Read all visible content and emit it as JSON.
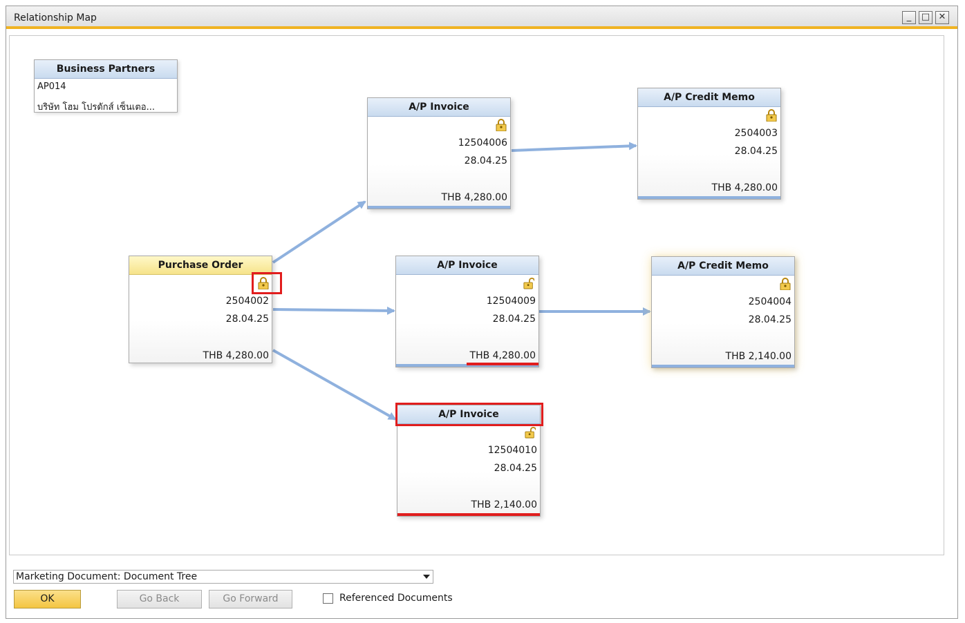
{
  "window": {
    "title": "Relationship Map",
    "minimize": "_",
    "maximize": "□",
    "close": "✕"
  },
  "business_partner": {
    "header": "Business Partners",
    "code": "AP014",
    "name": "บริษัท โฮม โปรดักส์ เซ็นเตอ..."
  },
  "documents": [
    {
      "id": "po",
      "header": "Purchase Order",
      "number": "2504002",
      "date": "28.04.25",
      "amount": "THB 4,280.00",
      "lock": "locked"
    },
    {
      "id": "inv1",
      "header": "A/P Invoice",
      "number": "12504006",
      "date": "28.04.25",
      "amount": "THB 4,280.00",
      "lock": "locked"
    },
    {
      "id": "inv2",
      "header": "A/P Invoice",
      "number": "12504009",
      "date": "28.04.25",
      "amount": "THB 4,280.00",
      "lock": "unlocked"
    },
    {
      "id": "inv3",
      "header": "A/P Invoice",
      "number": "12504010",
      "date": "28.04.25",
      "amount": "THB 2,140.00",
      "lock": "unlocked"
    },
    {
      "id": "cm1",
      "header": "A/P Credit Memo",
      "number": "2504003",
      "date": "28.04.25",
      "amount": "THB 4,280.00",
      "lock": "locked"
    },
    {
      "id": "cm2",
      "header": "A/P Credit Memo",
      "number": "2504004",
      "date": "28.04.25",
      "amount": "THB 2,140.00",
      "lock": "locked"
    }
  ],
  "footer": {
    "view_select": "Marketing Document: Document Tree",
    "ok": "OK",
    "go_back": "Go Back",
    "go_forward": "Go Forward",
    "referenced_documents": "Referenced Documents",
    "referenced_checked": false
  },
  "colors": {
    "accent": "#f0b323",
    "arrow": "#8fb1de",
    "highlight": "#e11d1d"
  }
}
